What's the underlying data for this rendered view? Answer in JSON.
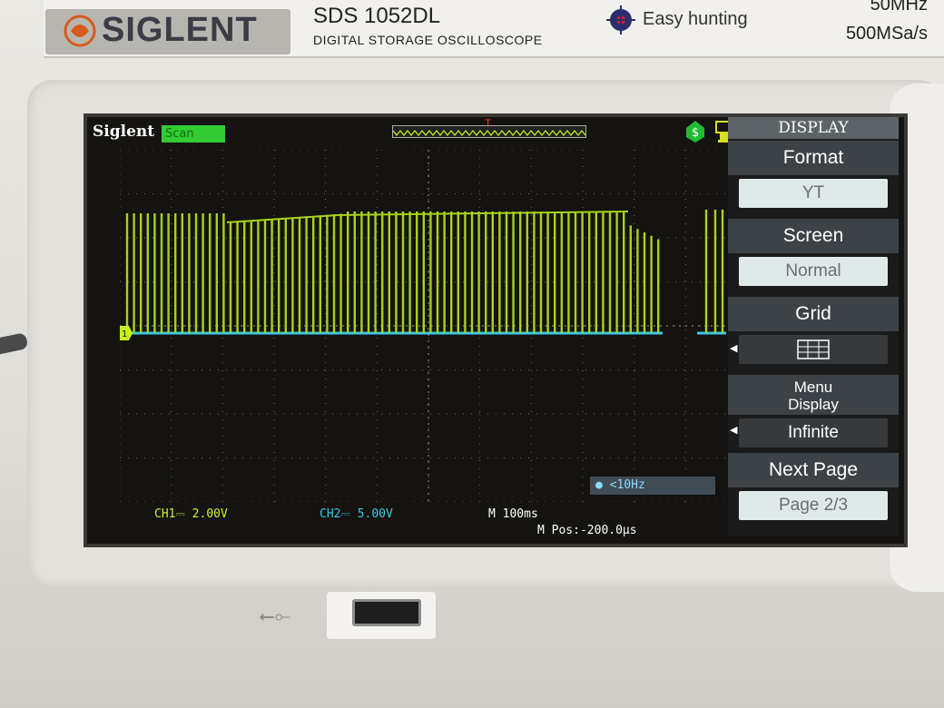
{
  "device": {
    "brand_logo": "SIGLENT",
    "model": "SDS 1052DL",
    "subtitle": "DIGITAL STORAGE OSCILLOSCOPE",
    "feature": "Easy hunting",
    "bandwidth": "50MHz",
    "sample_rate": "500MSa/s"
  },
  "screen": {
    "brand": "Siglent",
    "mode_badge": "Scan",
    "measurement": "<10Hz",
    "ch1_scale": "CH1⎓ 2.00V",
    "ch2_scale": "CH2⎓ 5.00V",
    "timebase": "M 100ms",
    "m_pos": "M Pos:-200.0μs",
    "trigger_marker": "T",
    "ch1_marker": "1",
    "icons": [
      "trigger-status-icon",
      "usb-storage-icon"
    ]
  },
  "menu": {
    "title": "DISPLAY",
    "format_label": "Format",
    "format_value": "YT",
    "screen_label": "Screen",
    "screen_value": "Normal",
    "grid_label": "Grid",
    "grid_value_icon": "grid-icon",
    "persist_label_line1": "Menu",
    "persist_label_line2": "Display",
    "persist_value": "Infinite",
    "next_label": "Next Page",
    "next_value": "Page 2/3"
  },
  "colors": {
    "ch1": "#c7f21e",
    "ch2": "#38c8e8",
    "menu_bg": "#3d4246",
    "badge": "#33cc33"
  }
}
